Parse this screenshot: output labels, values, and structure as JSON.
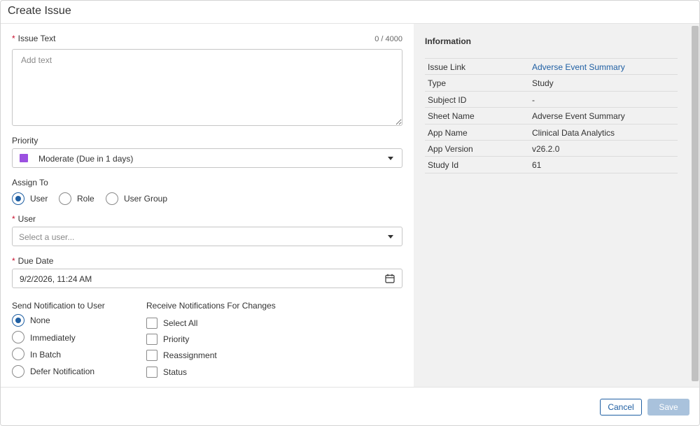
{
  "dialog": {
    "title": "Create Issue"
  },
  "issue_text": {
    "label": "Issue Text",
    "counter": "0 / 4000",
    "placeholder": "Add text",
    "value": ""
  },
  "priority": {
    "label": "Priority",
    "selected": "Moderate (Due in 1 days)",
    "swatch_color": "#9b51e0"
  },
  "assign_to": {
    "label": "Assign To",
    "options": [
      "User",
      "Role",
      "User Group"
    ],
    "selected": "User"
  },
  "user": {
    "label": "User",
    "placeholder": "Select a user..."
  },
  "due_date": {
    "label": "Due Date",
    "value": "9/2/2026, 11:24 AM"
  },
  "send_notification": {
    "label": "Send Notification to User",
    "options": [
      "None",
      "Immediately",
      "In Batch",
      "Defer Notification"
    ],
    "selected": "None"
  },
  "receive_notifications": {
    "label": "Receive Notifications For Changes",
    "options": [
      "Select All",
      "Priority",
      "Reassignment",
      "Status"
    ]
  },
  "information": {
    "title": "Information",
    "rows": [
      {
        "key": "Issue Link",
        "value": "Adverse Event Summary"
      },
      {
        "key": "Type",
        "value": "Study"
      },
      {
        "key": "Subject ID",
        "value": "-"
      },
      {
        "key": "Sheet Name",
        "value": "Adverse Event Summary"
      },
      {
        "key": "App Name",
        "value": "Clinical Data Analytics"
      },
      {
        "key": "App Version",
        "value": "v26.2.0"
      },
      {
        "key": "Study Id",
        "value": "61"
      }
    ]
  },
  "footer": {
    "cancel_label": "Cancel",
    "save_label": "Save"
  },
  "colors": {
    "accent": "#1f5fa3",
    "required": "#c8102e",
    "save_disabled": "#a9c2dc"
  }
}
